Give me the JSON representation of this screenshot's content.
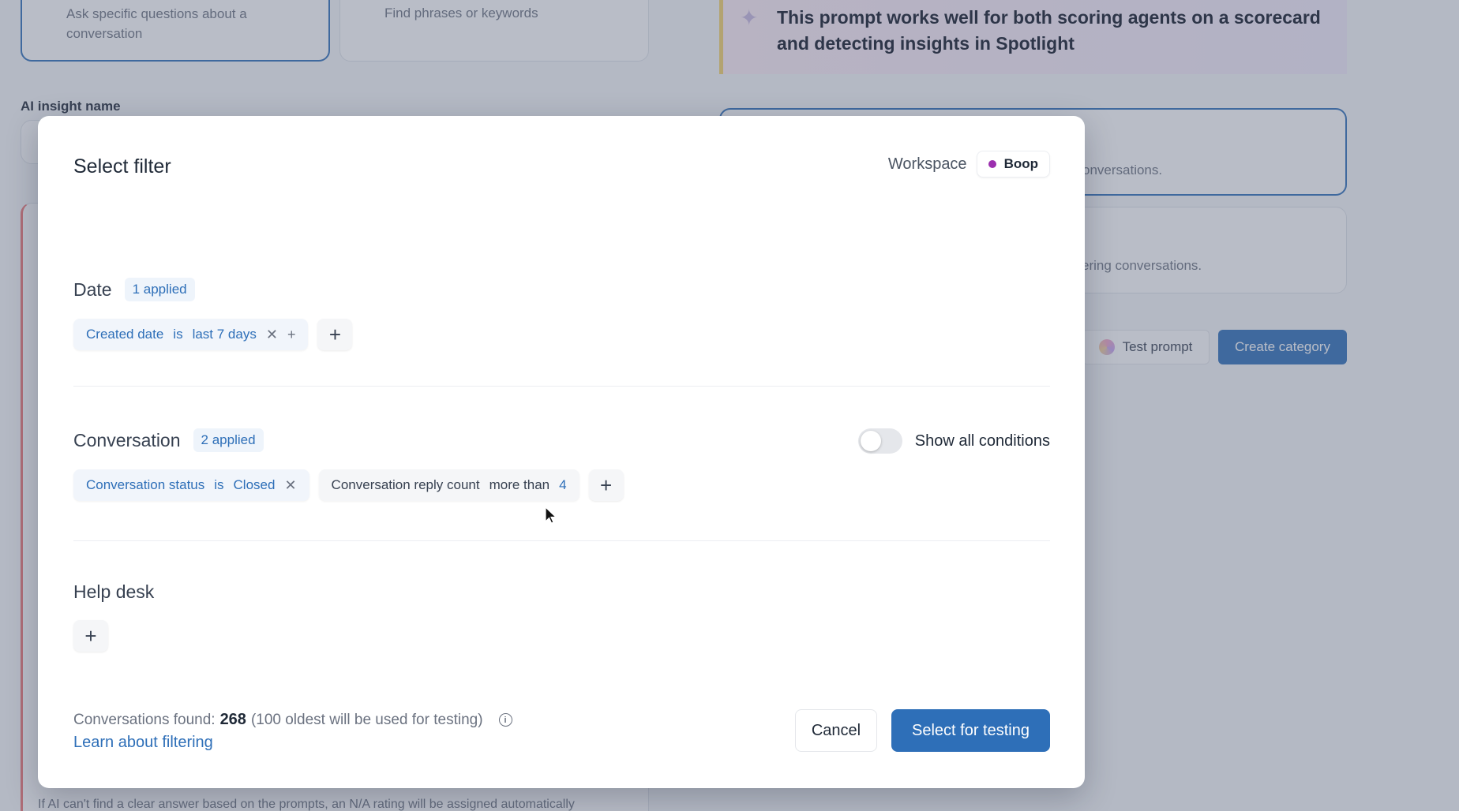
{
  "background": {
    "card1_text": "Ask specific questions about a conversation",
    "card2_text": "Find phrases or keywords",
    "insight_name_label": "AI insight name",
    "banner_text": "This prompt works well for both scoring agents on a scorecard and detecting insights in Spotlight",
    "right_card1_text": "onversations.",
    "right_card2_text": "ering conversations.",
    "test_prompt_label": "Test prompt",
    "create_category_label": "Create category",
    "bottom_text": "If AI can't find a clear answer based on the prompts, an N/A rating will be assigned automatically"
  },
  "modal": {
    "title": "Select filter",
    "workspace_label": "Workspace",
    "workspace_name": "Boop",
    "workspace_color": "#9b2fae",
    "date": {
      "title": "Date",
      "badge": "1 applied",
      "chip": {
        "field": "Created date",
        "op": "is",
        "value": "last 7 days"
      }
    },
    "conversation": {
      "title": "Conversation",
      "badge": "2 applied",
      "toggle_label": "Show all conditions",
      "toggle_on": false,
      "chip1": {
        "field": "Conversation status",
        "op": "is",
        "value": "Closed"
      },
      "chip2": {
        "field": "Conversation reply count",
        "op": "more than",
        "value": "4"
      }
    },
    "helpdesk": {
      "title": "Help desk"
    },
    "footer": {
      "found_label": "Conversations found:",
      "found_count": "268",
      "found_note": "(100 oldest will be used for testing)",
      "learn_link": "Learn about filtering",
      "cancel_label": "Cancel",
      "primary_label": "Select for testing"
    }
  },
  "colors": {
    "accent": "#2e6fb8",
    "overlay": "rgba(88, 98, 122, 0.42)"
  }
}
